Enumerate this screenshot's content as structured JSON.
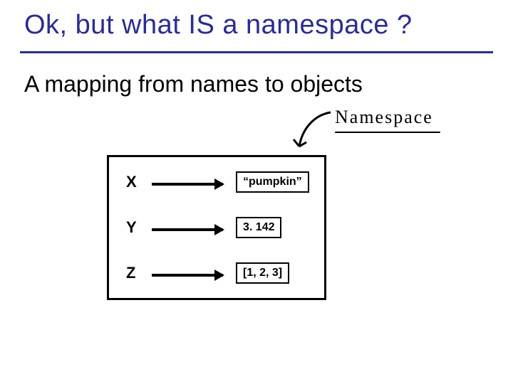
{
  "title": "Ok, but what IS a namespace ?",
  "subtitle": "A mapping from names to objects",
  "annotation": "Namespace",
  "rows": [
    {
      "name": "X",
      "value": "“pumpkin”"
    },
    {
      "name": "Y",
      "value": "3. 142"
    },
    {
      "name": "Z",
      "value": "[1, 2, 3]"
    }
  ]
}
